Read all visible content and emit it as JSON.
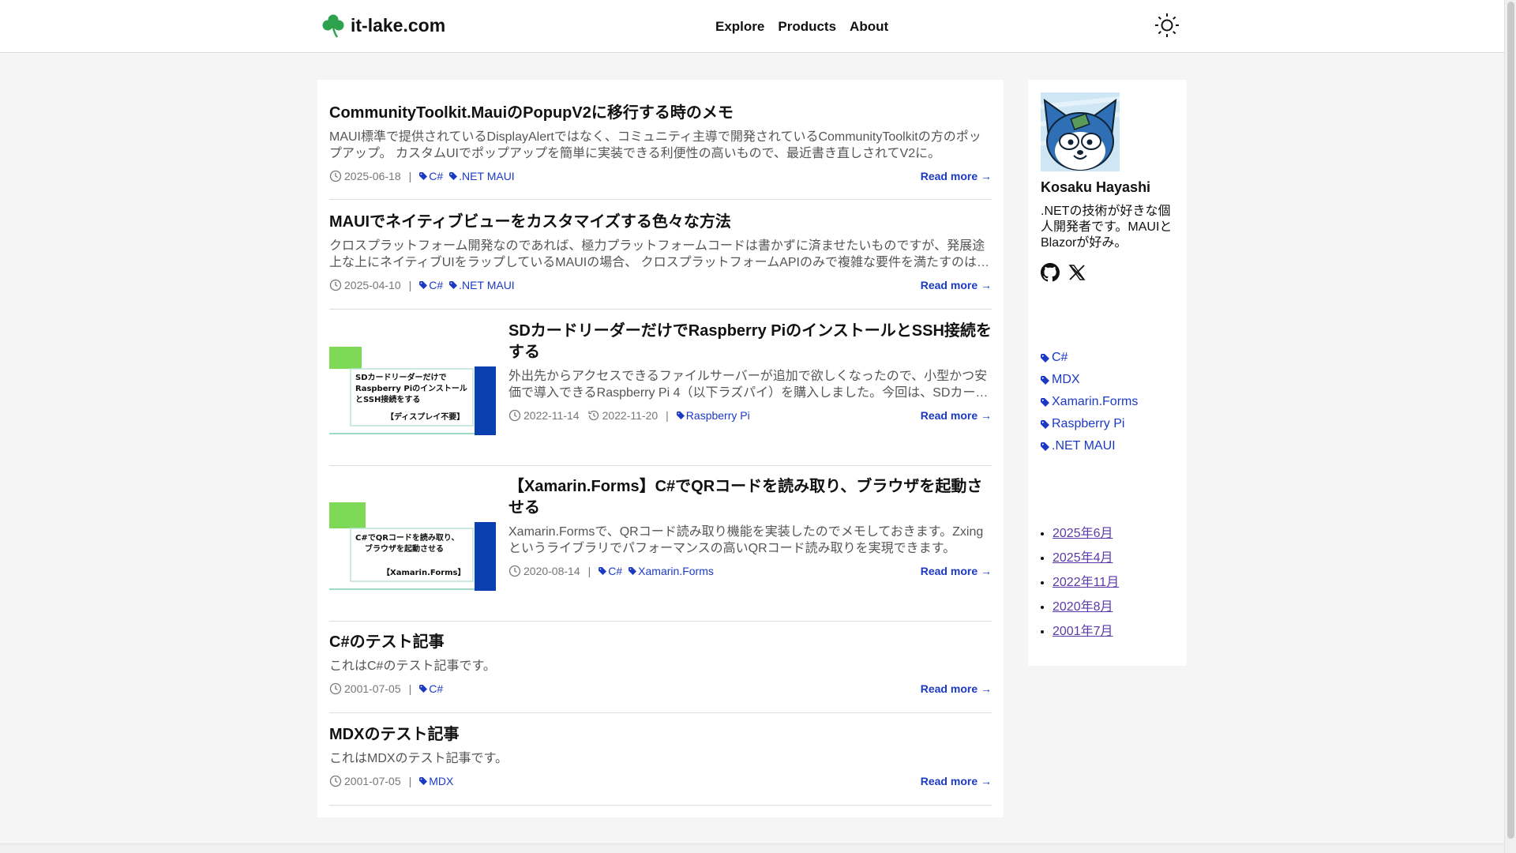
{
  "site": {
    "name": "it-lake.com"
  },
  "nav": {
    "explore": "Explore",
    "products": "Products",
    "about": "About"
  },
  "posts": [
    {
      "title": "CommunityToolkit.MauiのPopupV2に移行する時のメモ",
      "summary": "MAUI標準で提供されているDisplayAlertではなく、コミュニティ主導で開発されているCommunityToolkitの方のポップアップ。 カスタムUIでポップアップを簡単に実装できる利便性の高いもので、最近書き直しされてV2に。",
      "date": "2025-06-18",
      "tags": [
        "C#",
        ".NET MAUI"
      ],
      "read_more": "Read more →"
    },
    {
      "title": "MAUIでネイティブビューをカスタマイズする色々な方法",
      "summary": "クロスプラットフォーム開発なのであれば、極力プラットフォームコードは書かずに済ませたいものですが、発展途上な上にネイティブUIをラップしているMAUIの場合、 クロスプラットフォームAPIのみで複雑な要件を満たすのは難しいことがあります。",
      "date": "2025-04-10",
      "tags": [
        "C#",
        ".NET MAUI"
      ],
      "read_more": "Read more →"
    },
    {
      "title": "SDカードリーダーだけでRaspberry PiのインストールとSSH接続をする",
      "summary": "外出先からアクセスできるファイルサーバーが追加で欲しくなったので、小型かつ安価で導入できるRaspberry Pi 4（以下ラズパイ）を購入しました。今回は、SDカードリーダーだけで初期設定を行う方法です。",
      "date": "2022-11-14",
      "updated": "2022-11-20",
      "tags": [
        "Raspberry Pi"
      ],
      "read_more": "Read more →",
      "thumb_lines": [
        "SDカードリーダーだけで",
        "Raspberry Piのインストール",
        "とSSH接続をする",
        "【ディスプレイ不要】"
      ]
    },
    {
      "title": "【Xamarin.Forms】C#でQRコードを読み取り、ブラウザを起動させる",
      "summary": "Xamarin.Formsで、QRコード読み取り機能を実装したのでメモしておきます。Zxingというライブラリでパフォーマンスの高いQRコード読み取りを実現できます。",
      "date": "2020-08-14",
      "tags": [
        "C#",
        "Xamarin.Forms"
      ],
      "read_more": "Read more →",
      "thumb_lines": [
        "C#でQRコードを読み取り、",
        "ブラウザを起動させる",
        "【Xamarin.Forms】"
      ]
    },
    {
      "title": "C#のテスト記事",
      "summary": "これはC#のテスト記事です。",
      "date": "2001-07-05",
      "tags": [
        "C#"
      ],
      "read_more": "Read more →"
    },
    {
      "title": "MDXのテスト記事",
      "summary": "これはMDXのテスト記事です。",
      "date": "2001-07-05",
      "tags": [
        "MDX"
      ],
      "read_more": "Read more →"
    }
  ],
  "meta_separator": "|",
  "author": {
    "name": "Kosaku Hayashi",
    "bio": ".NETの技術が好きな個人開発者です。MAUIとBlazorが好み。"
  },
  "sidebar_tags": [
    "C#",
    "MDX",
    "Xamarin.Forms",
    "Raspberry Pi",
    ".NET MAUI"
  ],
  "archives": [
    "2025年6月",
    "2025年4月",
    "2022年11月",
    "2020年8月",
    "2001年7月"
  ],
  "colors": {
    "link": "#1c39c4",
    "visited": "#5b3aa8",
    "accent_green": "#7ed957",
    "thumb_blue": "#0a3fb0",
    "logo_green": "#2ca24c"
  },
  "icons": {
    "logo": "clover-icon",
    "theme": "sun-icon",
    "github": "github-icon",
    "x": "x-icon",
    "tag": "tag-icon",
    "clock": "clock-icon"
  }
}
